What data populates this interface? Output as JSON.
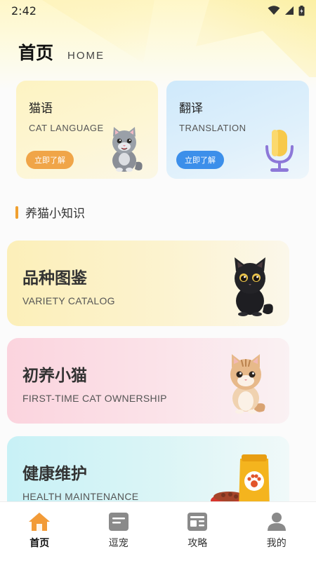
{
  "status_bar": {
    "time": "2:42"
  },
  "header": {
    "title": "首页",
    "subtitle": "HOME"
  },
  "feature_cards": [
    {
      "title": "猫语",
      "subtitle": "CAT LANGUAGE",
      "button": "立即了解"
    },
    {
      "title": "翻译",
      "subtitle": "TRANSLATION",
      "button": "立即了解"
    }
  ],
  "section": {
    "title": "养猫小知识"
  },
  "knowledge_cards": [
    {
      "title": "品种图鉴",
      "subtitle": "VARIETY CATALOG"
    },
    {
      "title": "初养小猫",
      "subtitle": "FIRST-TIME CAT OWNERSHIP"
    },
    {
      "title": "健康维护",
      "subtitle": "HEALTH MAINTENANCE"
    }
  ],
  "nav": [
    {
      "label": "首页",
      "icon": "home-icon",
      "active": true
    },
    {
      "label": "逗宠",
      "icon": "note-icon",
      "active": false
    },
    {
      "label": "攻略",
      "icon": "guide-icon",
      "active": false
    },
    {
      "label": "我的",
      "icon": "person-icon",
      "active": false
    }
  ],
  "colors": {
    "accent_orange": "#f0a548",
    "accent_blue": "#3c8fea",
    "home_icon": "#f29b38",
    "nav_icon_gray": "#8a8a8a"
  }
}
